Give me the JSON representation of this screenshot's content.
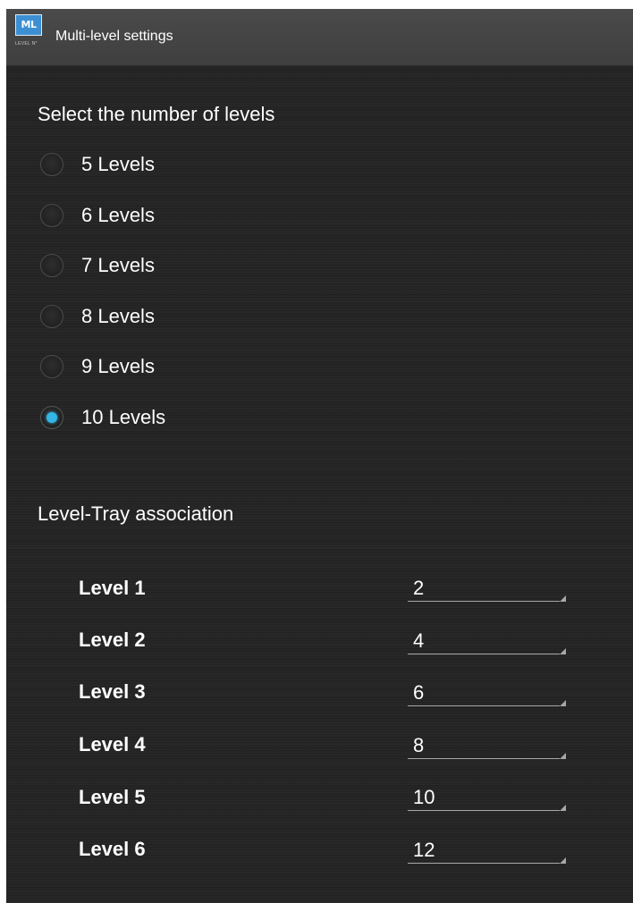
{
  "app": {
    "icon_text": "ML",
    "icon_subtext": "LEVEL N°",
    "title": "Multi-level settings"
  },
  "levels_section": {
    "title": "Select the number of levels",
    "options": [
      {
        "label": "5 Levels",
        "checked": false
      },
      {
        "label": "6 Levels",
        "checked": false
      },
      {
        "label": "7 Levels",
        "checked": false
      },
      {
        "label": "8 Levels",
        "checked": false
      },
      {
        "label": "9 Levels",
        "checked": false
      },
      {
        "label": "10 Levels",
        "checked": true
      }
    ],
    "selected": "10 Levels"
  },
  "tray_section": {
    "title": "Level-Tray association",
    "rows": [
      {
        "label": "Level 1",
        "value": "2"
      },
      {
        "label": "Level 2",
        "value": "4"
      },
      {
        "label": "Level 3",
        "value": "6"
      },
      {
        "label": "Level 4",
        "value": "8"
      },
      {
        "label": "Level 5",
        "value": "10"
      },
      {
        "label": "Level 6",
        "value": "12"
      }
    ]
  },
  "colors": {
    "accent": "#33b5e5",
    "background": "#232323",
    "action_bar": "#454545",
    "icon_blue": "#3c8fd2"
  }
}
